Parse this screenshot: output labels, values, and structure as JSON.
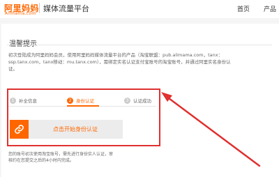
{
  "header": {
    "logo_cn": "阿里妈妈",
    "logo_en": "Alimama.com",
    "platform": "媒体流量平台",
    "nav": [
      "首页",
      "产品"
    ]
  },
  "notice": {
    "title": "温馨提示",
    "description": "初次登陆成为阿里妈妈会员，使用阿里妈妈媒体流量平台的产品（淘宝联盟：pub.alimama.com，tanx：ssp.tanx.com，tanx移动：mu.tanx.com），需绑定实名认证支付宝账号的淘宝账号，并通过阿里实名身份认证。"
  },
  "steps": [
    {
      "num": "1",
      "label": "补全信息"
    },
    {
      "num": "2",
      "label": "身份认证"
    },
    {
      "num": "3",
      "label": "认证成功"
    }
  ],
  "auth_button": {
    "label": "点击开始身份认证",
    "icon": "link-icon"
  },
  "note": "您的账号初次使用淘宝账号，需先进行身份实人认证，审核约在您提交之后的4小时内完成。",
  "colors": {
    "accent": "#ff6600",
    "highlight": "#e03030"
  }
}
